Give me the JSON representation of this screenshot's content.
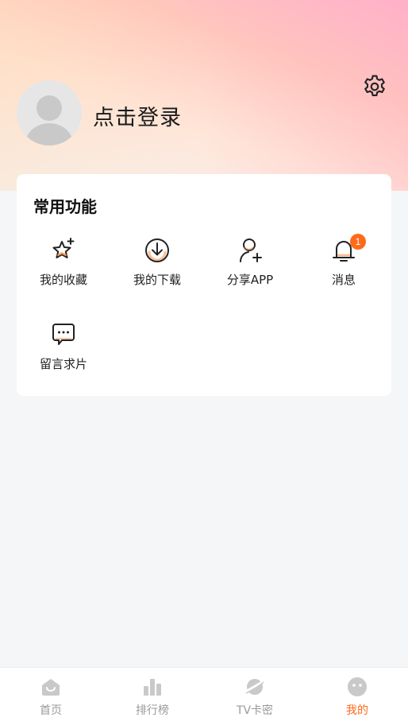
{
  "profile": {
    "login_text": "点击登录"
  },
  "common_functions": {
    "title": "常用功能",
    "items": [
      {
        "label": "我的收藏",
        "icon": "star-plus-icon"
      },
      {
        "label": "我的下载",
        "icon": "download-icon"
      },
      {
        "label": "分享APP",
        "icon": "share-user-icon"
      },
      {
        "label": "消息",
        "icon": "bell-icon",
        "badge": "1"
      },
      {
        "label": "留言求片",
        "icon": "message-icon"
      }
    ]
  },
  "tabbar": {
    "items": [
      {
        "label": "首页",
        "icon": "home-icon",
        "active": false
      },
      {
        "label": "排行榜",
        "icon": "ranking-icon",
        "active": false
      },
      {
        "label": "TV卡密",
        "icon": "planet-icon",
        "active": false
      },
      {
        "label": "我的",
        "icon": "mine-face-icon",
        "active": true
      }
    ]
  },
  "colors": {
    "accent": "#ff6a1a",
    "tab_inactive": "#9a9a9a",
    "badge": "#ff6a1a"
  }
}
